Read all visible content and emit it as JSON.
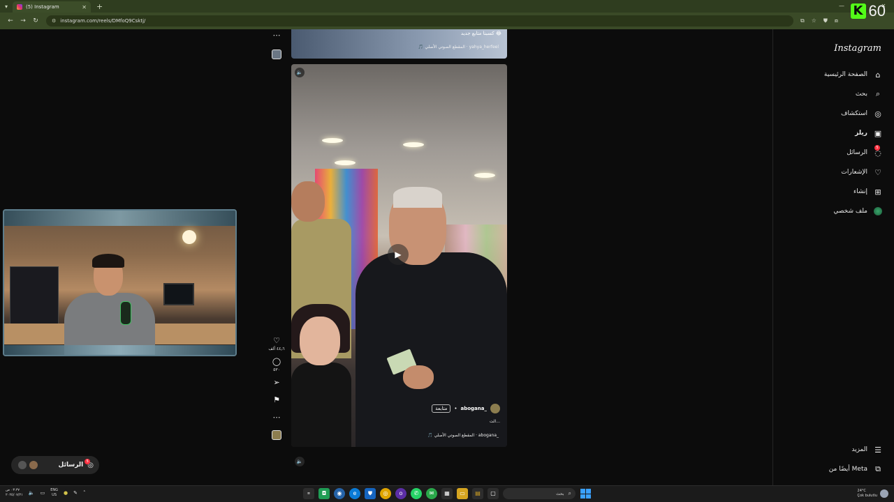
{
  "browser": {
    "tab_title": "(5) Instagram",
    "new_tab": "+",
    "url": "instagram.com/reels/DMfoQ9Csktj/"
  },
  "kick": {
    "logo_letter": "K",
    "viewer_count": "60"
  },
  "instagram": {
    "logo": "Instagram",
    "nav": [
      {
        "label": "الصفحة الرئيسية",
        "icon": "home-icon"
      },
      {
        "label": "بحث",
        "icon": "search-icon"
      },
      {
        "label": "استكشاف",
        "icon": "compass-icon"
      },
      {
        "label": "ريلز",
        "icon": "reels-icon"
      },
      {
        "label": "الرسائل",
        "icon": "messenger-icon",
        "badge": "5"
      },
      {
        "label": "الإشعارات",
        "icon": "heart-icon"
      },
      {
        "label": "إنشاء",
        "icon": "create-icon"
      },
      {
        "label": "ملف شخصي",
        "icon": "profile-avatar"
      }
    ],
    "more": "المزيد",
    "also_from_meta": "أيضًا من Meta"
  },
  "reel_prev": {
    "caption": "كسبنا متابع جديد 😂",
    "audio": "🎵 المقطع الصوتي الأصلي · yahya_herfeel"
  },
  "reel": {
    "username": "_abogana",
    "follow": "متابعة",
    "caption_more": "الت...",
    "audio": "🎵 المقطع الصوتي الأصلي · abogana_"
  },
  "actions": {
    "like_count": "٤٤٫٦ ألف",
    "comment_count": "٥٣٠"
  },
  "messages_pill": {
    "label": "الرسائل",
    "badge": "5"
  },
  "taskbar": {
    "clock_time": "٠٣:٣٧ ص",
    "clock_date": "٢٠٢٥/٠٧/٢١",
    "lang_top": "ENG",
    "lang_bottom": "US",
    "search_placeholder": "بحث",
    "weather_temp": "24°C",
    "weather_desc": "Çok bulutlu"
  },
  "colors": {
    "chrome_tab": "#2f3d1f",
    "chrome_bar": "#3a4a27",
    "kick_green": "#53fc18",
    "ig_bg": "#0c0c0c",
    "notify_red": "#ff3040"
  }
}
